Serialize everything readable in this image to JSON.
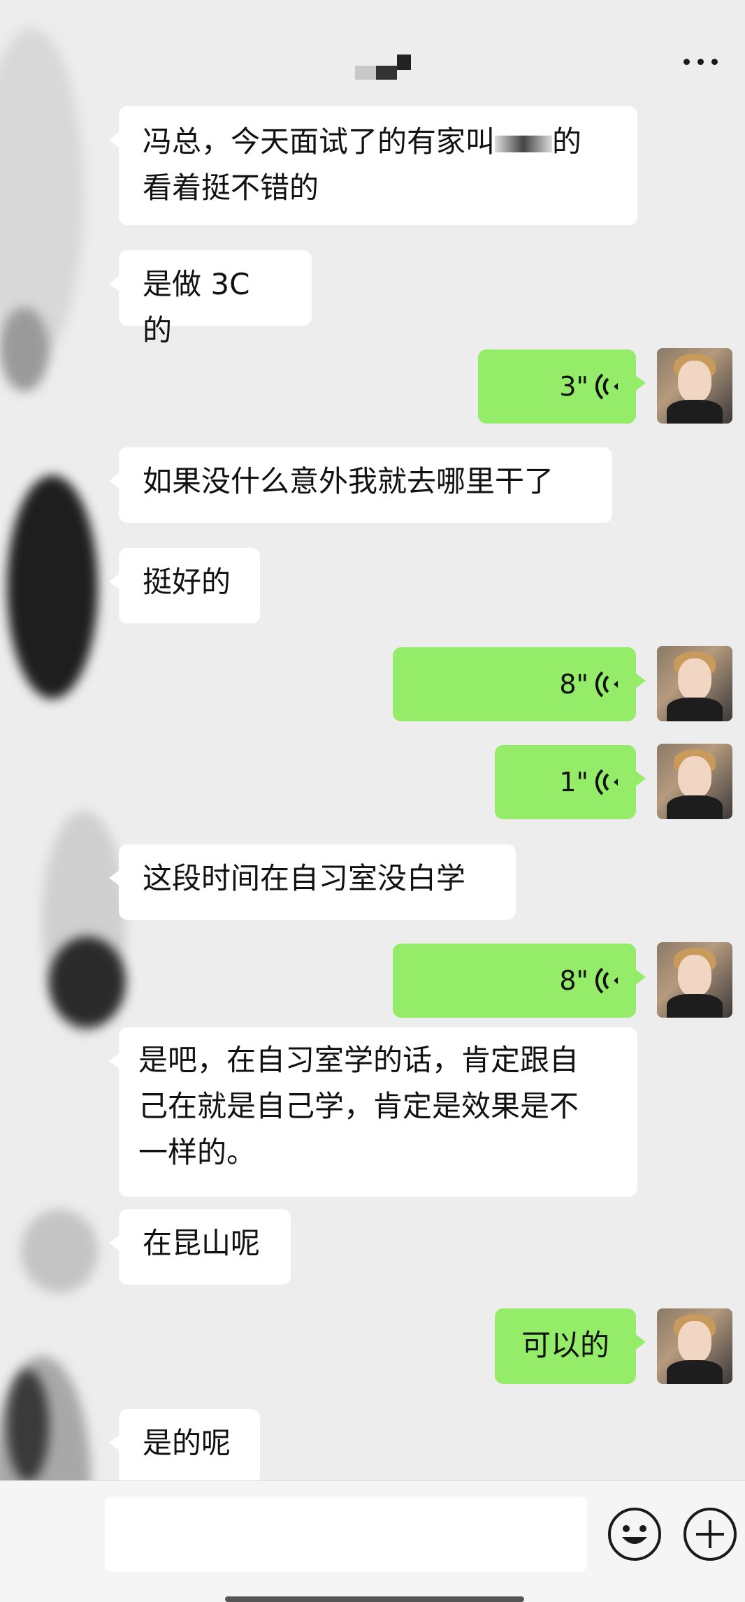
{
  "header": {
    "title": "",
    "more_icon": "more-horizontal-icon"
  },
  "messages": [
    {
      "side": "in",
      "type": "text",
      "lines": [
        "冯总，今天面试了的有家叫",
        "看着挺不错的"
      ],
      "line1_suffix": "的"
    },
    {
      "side": "in",
      "type": "text",
      "text": "是做 3C 的"
    },
    {
      "side": "out",
      "type": "voice",
      "duration": "3\""
    },
    {
      "side": "in",
      "type": "text",
      "text": "如果没什么意外我就去哪里干了"
    },
    {
      "side": "in",
      "type": "text",
      "text": "挺好的"
    },
    {
      "side": "out",
      "type": "voice",
      "duration": "8\""
    },
    {
      "side": "out",
      "type": "voice",
      "duration": "1\""
    },
    {
      "side": "in",
      "type": "text",
      "text": "这段时间在自习室没白学"
    },
    {
      "side": "out",
      "type": "voice",
      "duration": "8\""
    },
    {
      "side": "in",
      "type": "text",
      "lines": [
        "是吧，在自习室学的话，肯定跟自",
        "己在就是自己学，肯定是效果是不",
        "一样的。"
      ]
    },
    {
      "side": "in",
      "type": "text",
      "text": "在昆山呢"
    },
    {
      "side": "out",
      "type": "text",
      "text": "可以的"
    },
    {
      "side": "in",
      "type": "text",
      "text": "是的呢"
    }
  ],
  "input_bar": {
    "emoji_icon": "emoji-smile-icon",
    "plus_icon": "plus-icon",
    "placeholder": ""
  },
  "colors": {
    "background": "#ededed",
    "incoming_bubble": "#ffffff",
    "outgoing_bubble": "#95ec69"
  }
}
